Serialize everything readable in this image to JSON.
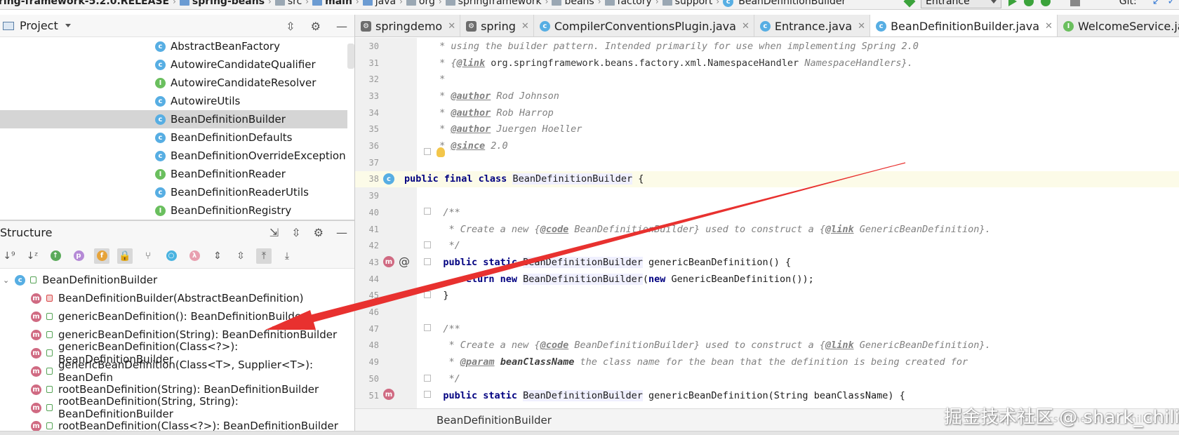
{
  "navbar": {
    "crumbs": [
      "ring-framework-5.2.0.RELEASE",
      "spring-beans",
      "src",
      "main",
      "java",
      "org",
      "springframework",
      "beans",
      "factory",
      "support",
      "BeanDefinitionBuilder"
    ],
    "run_config": "Entrance",
    "git_label": "Git:"
  },
  "project_panel": {
    "title": "Project",
    "items": [
      {
        "kind": "c",
        "label": "AbstractBeanFactory"
      },
      {
        "kind": "c",
        "label": "AutowireCandidateQualifier"
      },
      {
        "kind": "i",
        "label": "AutowireCandidateResolver"
      },
      {
        "kind": "c",
        "label": "AutowireUtils"
      },
      {
        "kind": "c",
        "label": "BeanDefinitionBuilder"
      },
      {
        "kind": "c",
        "label": "BeanDefinitionDefaults"
      },
      {
        "kind": "c",
        "label": "BeanDefinitionOverrideException"
      },
      {
        "kind": "i",
        "label": "BeanDefinitionReader"
      },
      {
        "kind": "c",
        "label": "BeanDefinitionReaderUtils"
      },
      {
        "kind": "i",
        "label": "BeanDefinitionRegistry"
      }
    ]
  },
  "structure_panel": {
    "title": "Structure",
    "root": "BeanDefinitionBuilder",
    "items": [
      {
        "label": "BeanDefinitionBuilder(AbstractBeanDefinition)"
      },
      {
        "label": "genericBeanDefinition(): BeanDefinitionBuilder"
      },
      {
        "label": "genericBeanDefinition(String): BeanDefinitionBuilder"
      },
      {
        "label": "genericBeanDefinition(Class<?>): BeanDefinitionBuilder"
      },
      {
        "label": "genericBeanDefinition(Class<T>, Supplier<T>): BeanDefin"
      },
      {
        "label": "rootBeanDefinition(String): BeanDefinitionBuilder"
      },
      {
        "label": "rootBeanDefinition(String, String): BeanDefinitionBuilder"
      },
      {
        "label": "rootBeanDefinition(Class<?>): BeanDefinitionBuilder"
      }
    ]
  },
  "tabs": [
    {
      "label": "springdemo",
      "icon": "gradle-icon"
    },
    {
      "label": "spring",
      "icon": "gradle-icon"
    },
    {
      "label": "CompilerConventionsPlugin.java",
      "icon": "class-icon"
    },
    {
      "label": "Entrance.java",
      "icon": "class-icon"
    },
    {
      "label": "BeanDefinitionBuilder.java",
      "icon": "class-icon"
    },
    {
      "label": "WelcomeService.java",
      "icon": "interface-icon"
    }
  ],
  "code": {
    "line_numbers": [
      "30",
      "31",
      "32",
      "33",
      "34",
      "35",
      "36",
      "37",
      "38",
      "39",
      "40",
      "41",
      "42",
      "43",
      "44",
      "45",
      "46",
      "47",
      "48",
      "49",
      "50",
      "51"
    ],
    "l30": " * using the builder pattern. Intended primarily for use when implementing Spring 2.0",
    "l31_tag": "@link",
    "l31_rest": " org.springframework.beans.factory.xml.NamespaceHandler ",
    "l31_end": "NamespaceHandlers}.",
    "l32": " *",
    "l33_tag": "@author",
    "l33_rest": " Rod Johnson",
    "l34_tag": "@author",
    "l34_rest": " Rob Harrop",
    "l35_tag": "@author",
    "l35_rest": " Juergen Hoeller",
    "l36_tag": "@since",
    "l36_rest": " 2.0",
    "l38_kw": "public final class ",
    "l38_name": "BeanDefinitionBuilder",
    "l38_rest": " {",
    "l40": "   /**",
    "l41_pre": "    * Create a new {",
    "l41_tag1": "@code",
    "l41_mid": " BeanDefinitionBuilder} used to construct a {",
    "l41_tag2": "@link",
    "l41_end": " GenericBeanDefinition}.",
    "l42": "    */",
    "l43_kw": "   public static ",
    "l43_type": "BeanDefinitionBuilder",
    "l43_rest": " genericBeanDefinition() {",
    "l44_kw": "      return new ",
    "l44_type": "BeanDefinitionBuilder",
    "l44_paren": "(",
    "l44_kw2": "new",
    "l44_rest": " GenericBeanDefinition());",
    "l45": "   }",
    "l47": "   /**",
    "l48_pre": "    * Create a new {",
    "l48_tag1": "@code",
    "l48_mid": " BeanDefinitionBuilder} used to construct a {",
    "l48_tag2": "@link",
    "l48_end": " GenericBeanDefinition}.",
    "l49_pre": "    * ",
    "l49_tag": "@param",
    "l49_param": " beanClassName",
    "l49_rest": " the class name for the bean that the definition is being created for",
    "l50": "    */",
    "l51_kw": "   public static ",
    "l51_type": "BeanDefinitionBuilder",
    "l51_rest": " genericBeanDefinition(String beanClassName) {"
  },
  "editor_breadcrumb": "BeanDefinitionBuilder",
  "watermark": {
    "text": "掘金技术社区 @ shark_chili",
    "url": "https://blog.csdn.net/shark_chili3007"
  },
  "colors": {
    "annotation_arrow": "#e8312f",
    "class_badge": "#57aee3",
    "interface_badge": "#6abf5e",
    "method_badge": "#d06a82"
  }
}
